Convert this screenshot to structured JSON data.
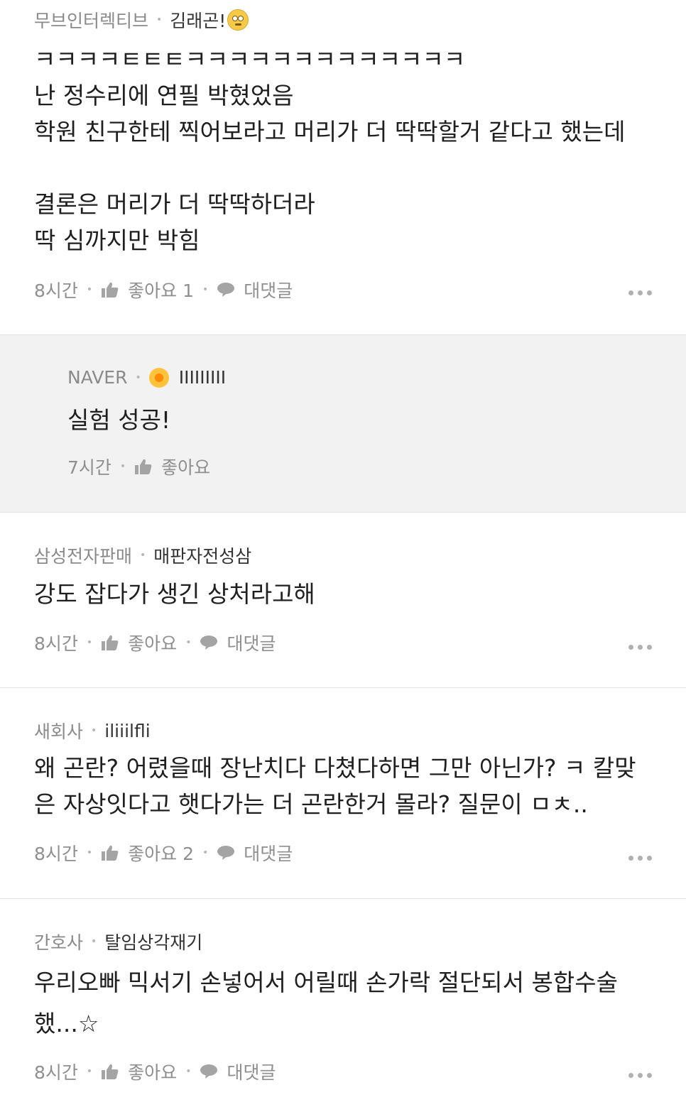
{
  "comments": [
    {
      "author": "무브인터렉티브",
      "nickname": "김래곤!",
      "has_emoji": true,
      "text": "ㅋㅋㅋㅋㅌㅌㅌㅋㅋㅋㅋㅋㅋㅋㅋㅋㅋㅋㅋㅋ\n난 정수리에 연필 박혔었음\n학원 친구한테 찍어보라고 머리가 더 딱딱할거 같다고 했는데\n\n결론은 머리가 더 딱딱하더라\n딱 심까지만 박힘",
      "time": "8시간",
      "like_label": "좋아요 1",
      "reply_label": "대댓글"
    },
    {
      "author": "NAVER",
      "nickname": "IIIIIIIII",
      "has_badge": true,
      "text": "실험 성공!",
      "time": "7시간",
      "like_label": "좋아요"
    },
    {
      "author": "삼성전자판매",
      "nickname": "매판자전성삼",
      "text": "강도 잡다가 생긴 상처라고해",
      "time": "8시간",
      "like_label": "좋아요",
      "reply_label": "대댓글"
    },
    {
      "author": "새회사",
      "nickname": "iliiilflі",
      "text": "왜 곤란? 어렸을때 장난치다 다쳤다하면 그만 아닌가? ㅋ 칼맞은 자상잇다고 햇다가는 더 곤란한거 몰라? 질문이 ㅁㅊ..",
      "time": "8시간",
      "like_label": "좋아요 2",
      "reply_label": "대댓글"
    },
    {
      "author": "간호사",
      "nickname": "탈임상각재기",
      "text": "우리오빠 믹서기 손넣어서 어릴때 손가락 절단되서 봉합수술했...☆",
      "time": "8시간",
      "like_label": "좋아요",
      "reply_label": "대댓글"
    }
  ],
  "icons": {
    "like": "thumbs-up-icon",
    "reply": "speech-bubble-icon",
    "more": "more-dots-icon"
  }
}
